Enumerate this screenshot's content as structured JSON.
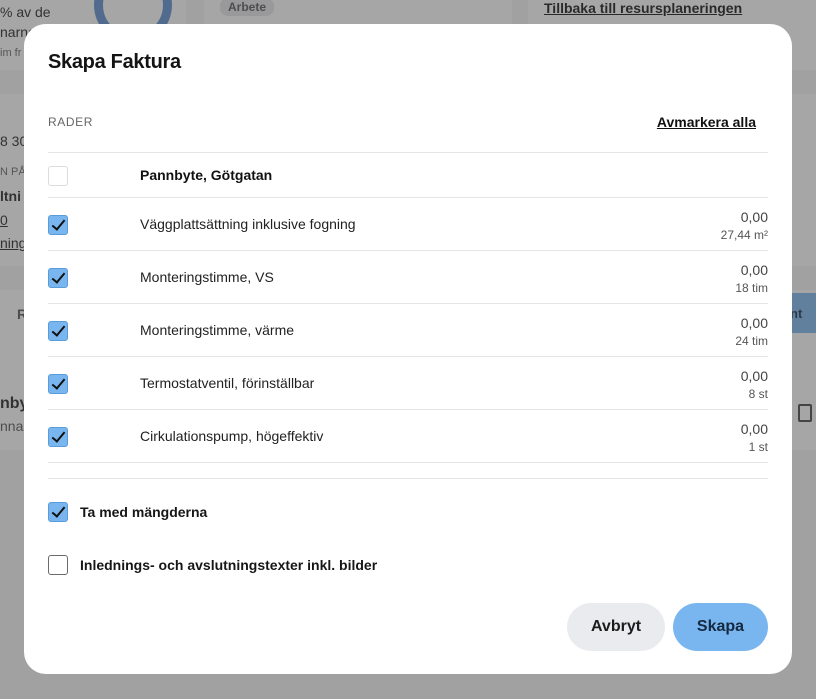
{
  "background": {
    "left_texts": [
      "% av de",
      "narna",
      "im fr",
      "8 30",
      "N PÅ",
      "ltni",
      "0",
      "ning",
      "Ri",
      "nbyt",
      "nna"
    ],
    "tag": "Arbete",
    "back_link": "Tillbaka till resursplaneringen",
    "pill_text": "nt"
  },
  "modal": {
    "title": "Skapa Faktura",
    "section_label": "RADER",
    "deselect_all": "Avmarkera alla",
    "group_row": {
      "label": "Pannbyte, Götgatan",
      "checked": false
    },
    "rows": [
      {
        "label": "Väggplattsättning inklusive fogning",
        "amount": "0,00",
        "quantity": "27,44 m²",
        "checked": true
      },
      {
        "label": "Monteringstimme, VS",
        "amount": "0,00",
        "quantity": "18 tim",
        "checked": true
      },
      {
        "label": "Monteringstimme, värme",
        "amount": "0,00",
        "quantity": "24 tim",
        "checked": true
      },
      {
        "label": "Termostatventil, förinställbar",
        "amount": "0,00",
        "quantity": "8 st",
        "checked": true
      },
      {
        "label": "Cirkulationspump, högeffektiv",
        "amount": "0,00",
        "quantity": "1 st",
        "checked": true
      }
    ],
    "options": [
      {
        "label": "Ta med mängderna",
        "checked": true
      },
      {
        "label": "Inlednings- och avslutningstexter inkl. bilder",
        "checked": false
      }
    ],
    "cancel_label": "Avbryt",
    "create_label": "Skapa"
  },
  "colors": {
    "accent": "#79b6f0",
    "overlay": "#8a8a8a"
  }
}
